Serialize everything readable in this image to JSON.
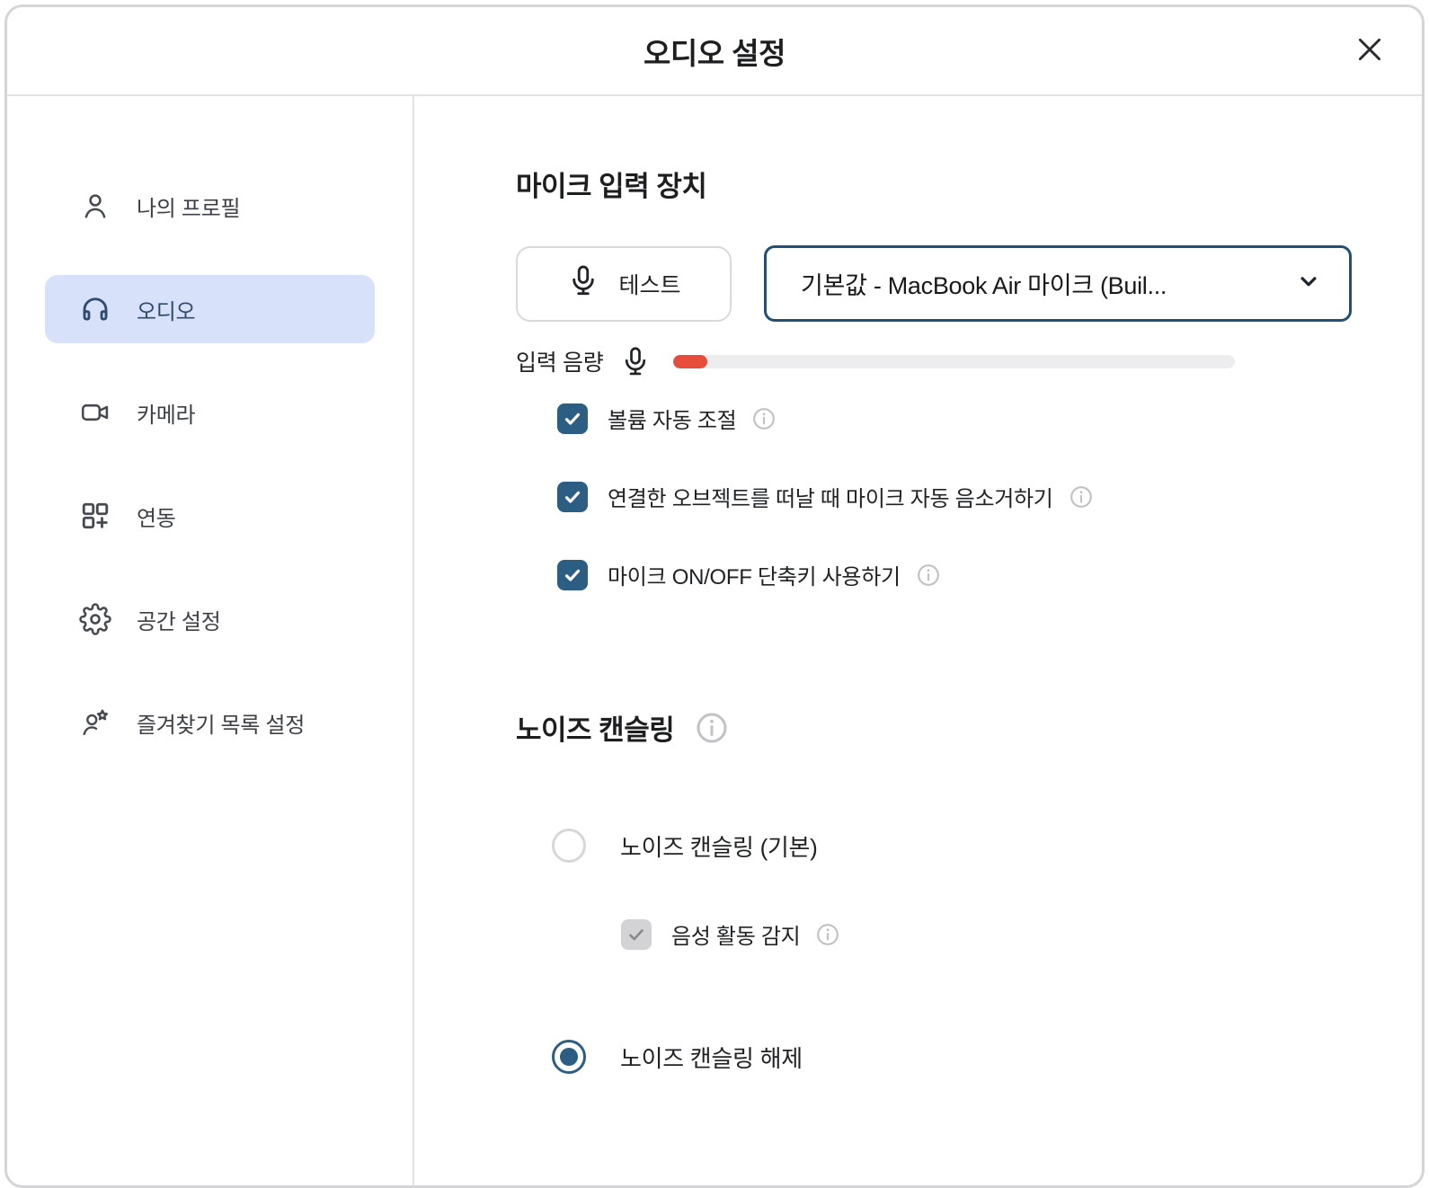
{
  "dialog": {
    "title": "오디오 설정"
  },
  "sidebar": {
    "items": [
      {
        "label": "나의 프로필",
        "icon": "person-icon",
        "selected": false
      },
      {
        "label": "오디오",
        "icon": "headphones-icon",
        "selected": true
      },
      {
        "label": "카메라",
        "icon": "camera-icon",
        "selected": false
      },
      {
        "label": "연동",
        "icon": "apps-add-icon",
        "selected": false
      },
      {
        "label": "공간 설정",
        "icon": "gear-icon",
        "selected": false
      },
      {
        "label": "즐겨찾기 목록 설정",
        "icon": "person-star-icon",
        "selected": false
      }
    ]
  },
  "mic_section": {
    "heading": "마이크 입력 장치",
    "test_button_label": "테스트",
    "device_select_value": "기본값 - MacBook Air 마이크 (Buil...",
    "input_volume_label": "입력 음량",
    "input_volume_percent": 6,
    "checkboxes": [
      {
        "label": "볼륨 자동 조절",
        "checked": true
      },
      {
        "label": "연결한 오브젝트를 떠날 때 마이크 자동 음소거하기",
        "checked": true
      },
      {
        "label": "마이크 ON/OFF 단축키 사용하기",
        "checked": true
      }
    ]
  },
  "noise_section": {
    "heading": "노이즈 캔슬링",
    "options": [
      {
        "label": "노이즈 캔슬링 (기본)",
        "selected": false
      },
      {
        "label": "노이즈 캔슬링 해제",
        "selected": true
      }
    ],
    "sub_checkbox": {
      "label": "음성 활동 감지",
      "checked": true,
      "disabled": true
    }
  },
  "colors": {
    "accent_blue": "#2c5d82",
    "select_border_blue": "#234e75",
    "sidebar_selected_bg": "#d8e1fa",
    "sidebar_selected_fg": "#2d4a70",
    "volume_red": "#e84c3b",
    "volume_track": "#ededf0"
  }
}
